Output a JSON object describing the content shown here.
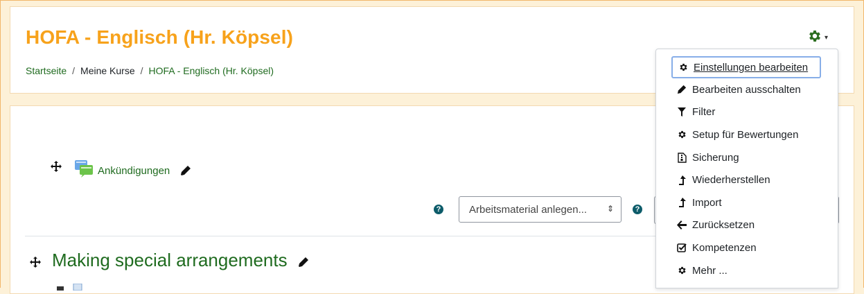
{
  "header": {
    "title": "HOFA - Englisch (Hr. Köpsel)",
    "breadcrumb": [
      {
        "label": "Startseite"
      },
      {
        "label": "Meine Kurse"
      },
      {
        "label": "HOFA - Englisch (Hr. Köpsel)"
      }
    ],
    "breadcrumb_separator": "/",
    "settings_icon": "gear-icon",
    "accent_color": "#f7a21b",
    "link_color": "#1f6b1f"
  },
  "course": {
    "announcements_label": "Ankündigungen",
    "activity_select_value": "Arbeitsmaterial anlegen...",
    "section_title": "Making special arrangements"
  },
  "menu": {
    "items": [
      {
        "label": "Einstellungen bearbeiten",
        "icon": "gear-icon"
      },
      {
        "label": "Bearbeiten ausschalten",
        "icon": "pencil-icon"
      },
      {
        "label": "Filter",
        "icon": "filter-icon"
      },
      {
        "label": "Setup für Bewertungen",
        "icon": "gear-icon"
      },
      {
        "label": "Sicherung",
        "icon": "file-archive-icon"
      },
      {
        "label": "Wiederherstellen",
        "icon": "level-up-icon"
      },
      {
        "label": "Import",
        "icon": "level-up-icon"
      },
      {
        "label": "Zurücksetzen",
        "icon": "arrow-left-icon"
      },
      {
        "label": "Kompetenzen",
        "icon": "check-square-icon"
      },
      {
        "label": "Mehr ...",
        "icon": "gear-icon"
      }
    ]
  }
}
